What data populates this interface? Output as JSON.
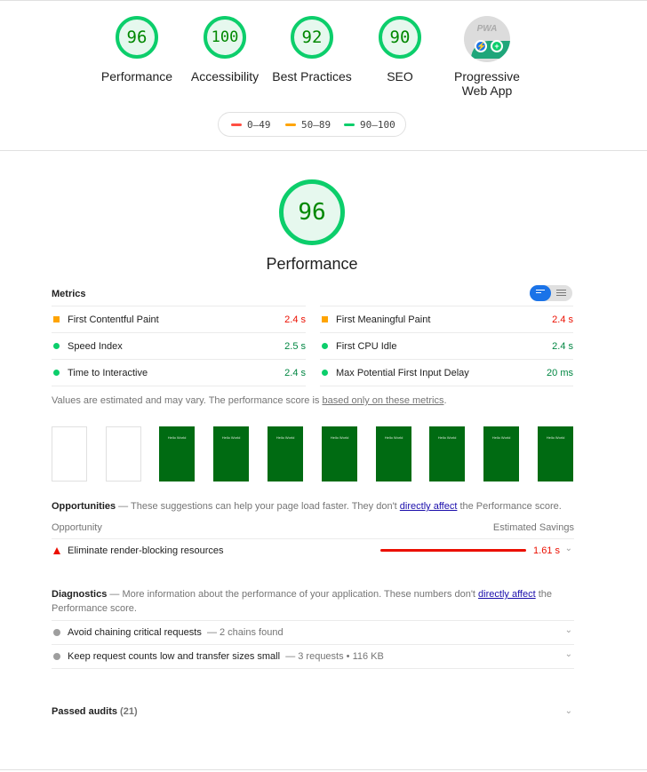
{
  "categories": [
    {
      "score": "96",
      "label": "Performance"
    },
    {
      "score": "100",
      "label": "Accessibility"
    },
    {
      "score": "92",
      "label": "Best Practices"
    },
    {
      "score": "90",
      "label": "SEO"
    }
  ],
  "pwa": {
    "label_line1": "Progressive",
    "label_line2": "Web App",
    "badge_text": "PWA",
    "icon": "pwa-badge-icon"
  },
  "legend": {
    "fail": "0–49",
    "average": "50–89",
    "pass": "90–100"
  },
  "colors": {
    "pass": "#0cce6b",
    "average": "#ffa400",
    "fail": "#ff4e42",
    "link": "#1a0dab"
  },
  "performance": {
    "score": "96",
    "title": "Performance"
  },
  "metrics": {
    "title": "Metrics",
    "items": [
      {
        "label": "First Contentful Paint",
        "value": "2.4 s",
        "status": "average"
      },
      {
        "label": "First Meaningful Paint",
        "value": "2.4 s",
        "status": "average"
      },
      {
        "label": "Speed Index",
        "value": "2.5 s",
        "status": "pass"
      },
      {
        "label": "First CPU Idle",
        "value": "2.4 s",
        "status": "pass"
      },
      {
        "label": "Time to Interactive",
        "value": "2.4 s",
        "status": "pass"
      },
      {
        "label": "Max Potential First Input Delay",
        "value": "20 ms",
        "status": "pass"
      }
    ]
  },
  "note": {
    "text": "Values are estimated and may vary. The performance score is ",
    "link": "based only on these metrics",
    "end": "."
  },
  "filmstrip": {
    "frame_text": "Hello World"
  },
  "opportunities": {
    "title": "Opportunities",
    "desc": " — These suggestions can help your page load faster. They don't ",
    "link": "directly affect",
    "desc_end": " the Performance score.",
    "col_left": "Opportunity",
    "col_right": "Estimated Savings",
    "items": [
      {
        "label": "Eliminate render-blocking resources",
        "value": "1.61 s"
      }
    ]
  },
  "diagnostics": {
    "title": "Diagnostics",
    "desc": " — More information about the performance of your application. These numbers don't ",
    "link": "directly affect",
    "desc_end": " the Performance score.",
    "items": [
      {
        "label": "Avoid chaining critical requests",
        "sub": "— 2 chains found"
      },
      {
        "label": "Keep request counts low and transfer sizes small",
        "sub": "— 3 requests • 116 KB"
      }
    ]
  },
  "passed": {
    "label": "Passed audits",
    "count": "(21)"
  }
}
